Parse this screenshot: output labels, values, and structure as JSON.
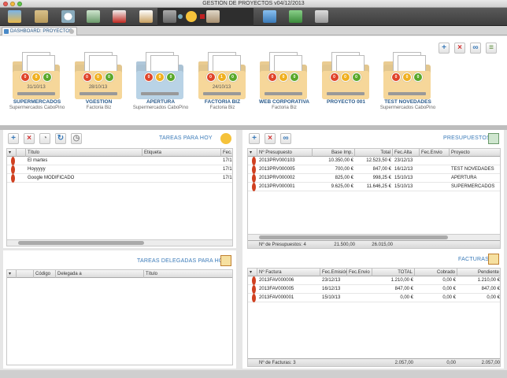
{
  "window": {
    "title": "GESTIÓN DE PROYECTOS v04/12/2013"
  },
  "tabs": [
    {
      "label": "DASHBOARD: PROYECTOS"
    }
  ],
  "projects": [
    {
      "name": "SUPERMERCADOS",
      "client": "Supermercados CaboPino",
      "date": "31/10/13",
      "color": "#f6d79a",
      "lights": [
        "0",
        "0",
        "0"
      ]
    },
    {
      "name": "VGESTION",
      "client": "Factoria Biz",
      "date": "28/10/13",
      "color": "#f6d79a",
      "lights": [
        "0",
        "0",
        "0"
      ]
    },
    {
      "name": "APERTURA",
      "client": "Supermercados CaboPino",
      "date": "",
      "color": "#b9d3e6",
      "lights": [
        "0",
        "0",
        "0"
      ]
    },
    {
      "name": "FACTORIA BIZ",
      "client": "Factoria Biz",
      "date": "24/10/13",
      "color": "#f6d79a",
      "lights": [
        "0",
        "1",
        "0"
      ]
    },
    {
      "name": "WEB CORPORATIVA",
      "client": "Factoria Biz",
      "date": "",
      "color": "#f6d79a",
      "lights": [
        "0",
        "0",
        "0"
      ]
    },
    {
      "name": "PROYECTO 001",
      "client": "",
      "date": "",
      "color": "#f6d79a",
      "lights": [
        "0",
        "0",
        "0"
      ]
    },
    {
      "name": "TEST NOVEDADES",
      "client": "Supermercados CaboPino",
      "date": "",
      "color": "#f6d79a",
      "lights": [
        "0",
        "0",
        "0"
      ]
    }
  ],
  "tareas": {
    "title": "TAREAS PARA HOY",
    "headers": [
      "Título",
      "Etiqueta",
      "Fec.C"
    ],
    "rows": [
      {
        "titulo": "El martes",
        "etiqueta": "",
        "fec": "17/1"
      },
      {
        "titulo": "Hoyyyyy",
        "etiqueta": "",
        "fec": "17/1"
      },
      {
        "titulo": "Google MODIFICADO",
        "etiqueta": "",
        "fec": "17/1"
      }
    ]
  },
  "delegadas": {
    "title": "TAREAS DELEGADAS PARA HOY",
    "headers": [
      "Código",
      "Delegada a",
      "Título"
    ]
  },
  "presupuestos": {
    "title": "PRESUPUESTOS",
    "headers": [
      "Nº Presupuesto",
      "Base Imp.",
      "Total",
      "Fec.Alta",
      "Fec.Envio",
      "Proyecto"
    ],
    "rows": [
      {
        "num": "2013PRV000103",
        "base": "10.350,00 €",
        "total": "12.523,50 €",
        "alta": "23/12/13",
        "envio": "",
        "proyecto": ""
      },
      {
        "num": "2013PRV000005",
        "base": "700,00 €",
        "total": "847,00 €",
        "alta": "16/12/13",
        "envio": "",
        "proyecto": "TEST NOVEDADES"
      },
      {
        "num": "2013PRV000002",
        "base": "825,00 €",
        "total": "998,25 €",
        "alta": "15/10/13",
        "envio": "",
        "proyecto": "APERTURA"
      },
      {
        "num": "2013PRV000001",
        "base": "9.625,00 €",
        "total": "11.646,25 €",
        "alta": "15/10/13",
        "envio": "",
        "proyecto": "SUPERMERCADOS"
      }
    ],
    "footer": {
      "count_label": "Nº de Presupuestos: 4",
      "base_total": "21.500,00",
      "total_total": "26.015,00"
    }
  },
  "facturas": {
    "title": "FACTURAS",
    "headers": [
      "Nº Factura",
      "Fec.Emisión",
      "Fec.Envio",
      "TOTAL",
      "Cobrado",
      "Pendiente"
    ],
    "rows": [
      {
        "num": "2013FAV000006",
        "emision": "23/12/13",
        "envio": "",
        "total": "1.210,00 €",
        "cobrado": "0,00 €",
        "pendiente": "1.210,00 €"
      },
      {
        "num": "2013FAV000005",
        "emision": "16/12/13",
        "envio": "",
        "total": "847,00 €",
        "cobrado": "0,00 €",
        "pendiente": "847,00 €"
      },
      {
        "num": "2013FAV000001",
        "emision": "15/10/13",
        "envio": "",
        "total": "0,00 €",
        "cobrado": "0,00 €",
        "pendiente": "0,00 €"
      }
    ],
    "footer": {
      "count_label": "Nº de Facturas: 3",
      "total": "2.057,00",
      "cobrado": "0,00",
      "pendiente": "2.057,00"
    }
  },
  "colors": {
    "accent": "#3a7ab8",
    "status_dot": "#d04020",
    "light_red": "#e0452a",
    "light_yellow": "#f0b020",
    "light_green": "#5aa82a"
  }
}
